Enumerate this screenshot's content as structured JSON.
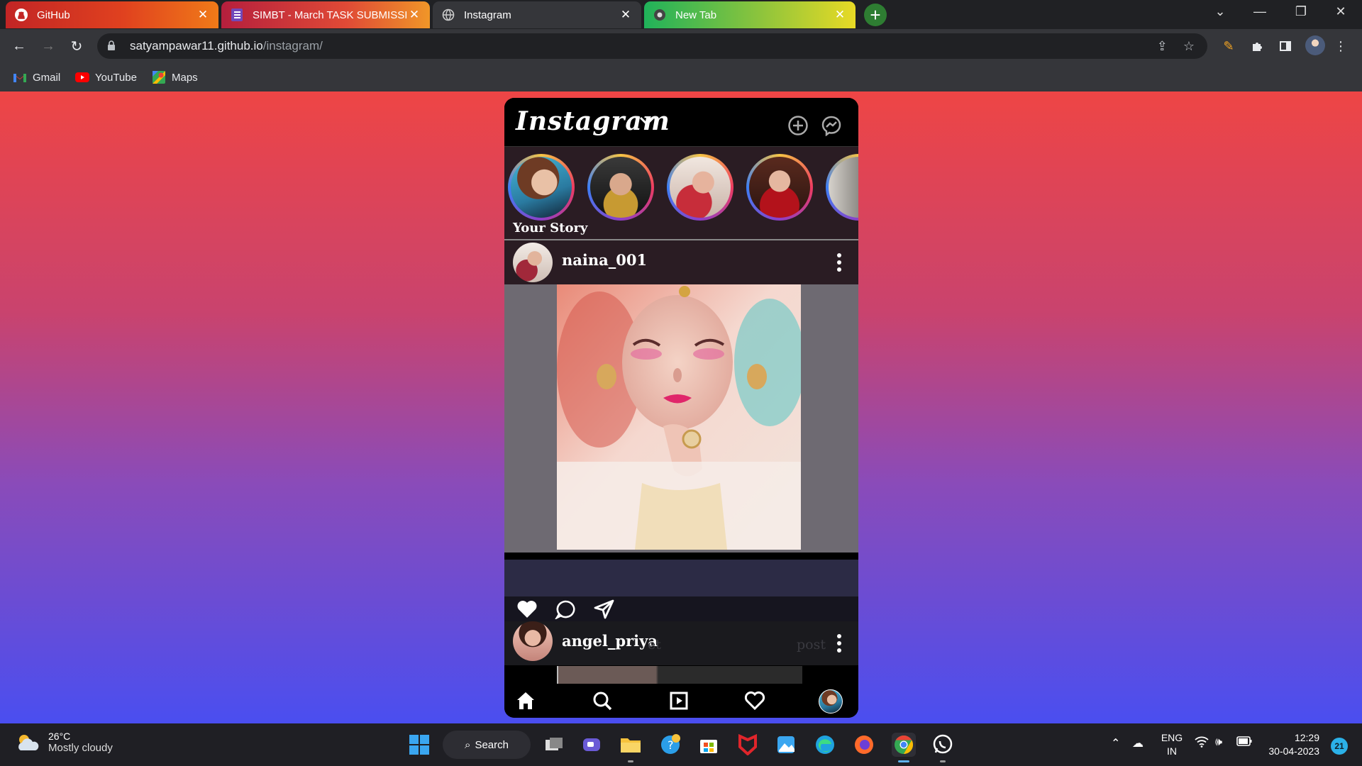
{
  "browser": {
    "tabs": [
      {
        "title": "GitHub",
        "icon": "github-icon"
      },
      {
        "title": "SIMBT - March TASK SUBMISSION",
        "icon": "forms-icon"
      },
      {
        "title": "Instagram",
        "icon": "globe-icon",
        "active": true
      },
      {
        "title": "New Tab",
        "icon": "chrome-icon"
      }
    ],
    "url_host": "satyampawar11.github.io",
    "url_path": "/instagram/",
    "bookmarks": [
      {
        "label": "Gmail",
        "icon": "gmail-icon"
      },
      {
        "label": "YouTube",
        "icon": "youtube-icon"
      },
      {
        "label": "Maps",
        "icon": "maps-icon"
      }
    ]
  },
  "app": {
    "logo": "Instagram",
    "header_icons": [
      "add-post-icon",
      "messenger-icon"
    ],
    "stories": [
      {
        "label": "Your Story"
      },
      {
        "label": ""
      },
      {
        "label": ""
      },
      {
        "label": ""
      },
      {
        "label": ""
      }
    ],
    "posts": [
      {
        "username": "naina_001"
      },
      {
        "username": "angel_priya",
        "faded_hint_a": "et",
        "faded_hint_b": "post"
      }
    ],
    "post_actions": [
      "heart-icon",
      "comment-icon",
      "share-icon"
    ],
    "bottom_nav": [
      "home-icon",
      "search-icon",
      "reels-icon",
      "activity-heart-icon",
      "profile-avatar"
    ]
  },
  "taskbar": {
    "weather_temp": "26°C",
    "weather_desc": "Mostly cloudy",
    "search_label": "Search",
    "lang_line1": "ENG",
    "lang_line2": "IN",
    "time": "12:29",
    "date": "30-04-2023",
    "notifications": "21"
  }
}
